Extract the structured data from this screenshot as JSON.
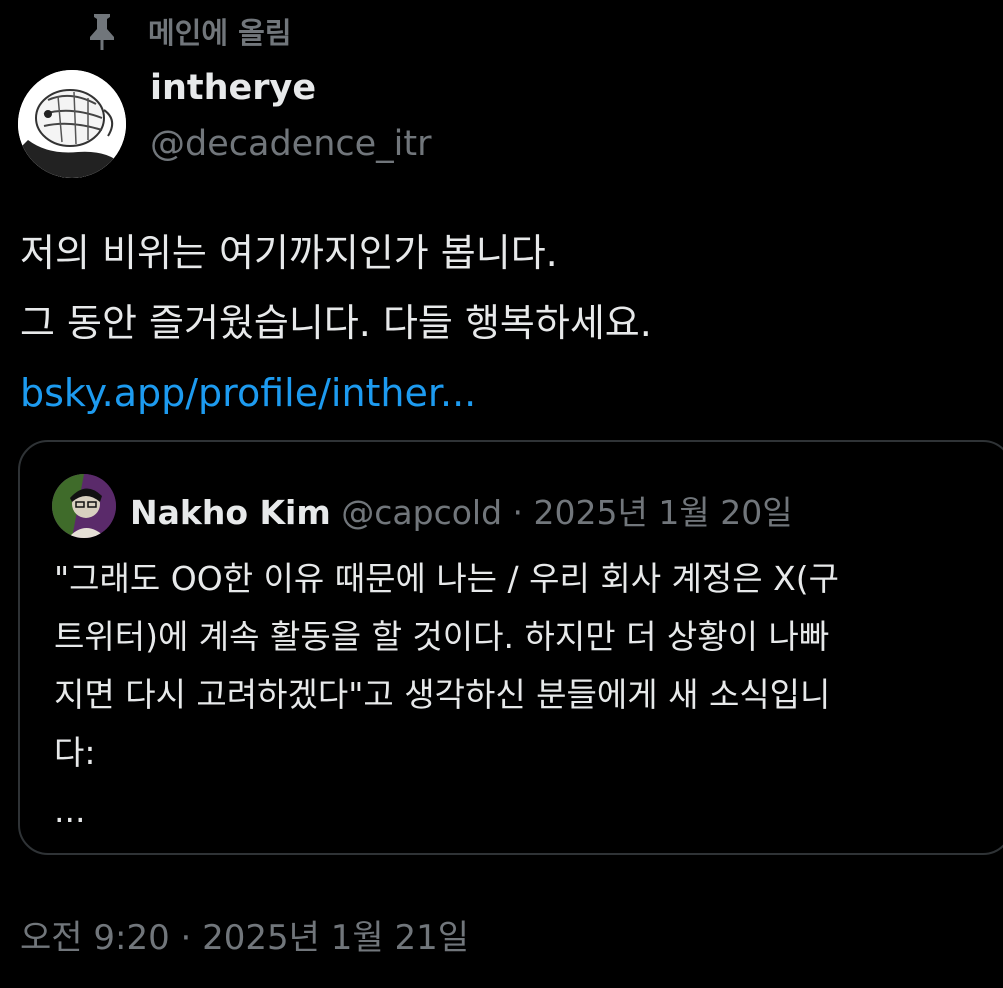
{
  "pinned": {
    "label": "메인에 올림",
    "icon": "pin-icon"
  },
  "author": {
    "name": "intherye",
    "handle": "@decadence_itr",
    "avatar": "avatar"
  },
  "tweet": {
    "lines": [
      "저의 비위는 여기까지인가 봅니다.",
      "그 동안 즐거웠습니다. 다들 행복하세요."
    ],
    "link": "bsky.app/profile/inther..."
  },
  "quote": {
    "name": "Nakho Kim",
    "handle": "@capcold",
    "separator": "·",
    "date": "2025년 1월 20일",
    "lines": [
      "\"그래도 OO한 이유 때문에 나는 / 우리 회사 계정은 X(구",
      "트위터)에 계속 활동을 할 것이다. 하지만 더 상황이 나빠",
      "지면 다시 고려하겠다\"고 생각하신 분들에게 새 소식입니",
      "다:",
      "..."
    ]
  },
  "timestamp": {
    "time": "오전 9:20",
    "separator": "·",
    "date": "2025년 1월 21일"
  },
  "colors": {
    "background": "#000000",
    "text": "#e7e9ea",
    "muted": "#71767b",
    "link": "#1d9bf0",
    "border": "#2f3336"
  }
}
